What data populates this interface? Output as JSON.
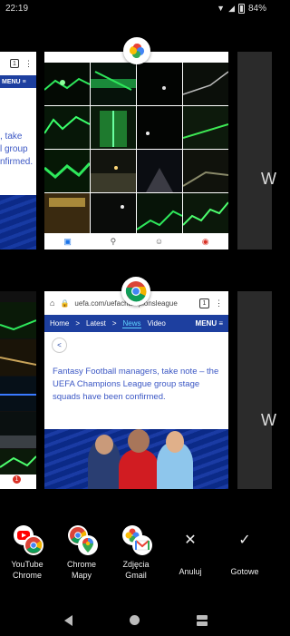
{
  "status_bar": {
    "time": "22:19",
    "battery": "84%"
  },
  "left_top_card": {
    "tab_count": "1",
    "nav_menu": "MENU",
    "snippet": ", take\nl group\nnfirmed."
  },
  "right_cards": {
    "top_letter": "W",
    "bottom_letter": "W"
  },
  "chrome_card": {
    "url": "uefa.com/uefachampionsleague",
    "tab_count": "1",
    "nav_items": [
      "Home",
      ">",
      "Latest",
      ">",
      "News",
      "Video"
    ],
    "nav_menu": "MENU ≡",
    "article_text": "Fantasy Football managers, take note – the UEFA Champions League group stage squads have been confirmed."
  },
  "left_bottom_card": {
    "badge": "1"
  },
  "app_pairs": [
    {
      "label_line1": "YouTube",
      "label_line2": "Chrome",
      "icons": [
        "youtube-icon",
        "chrome-icon"
      ]
    },
    {
      "label_line1": "Chrome",
      "label_line2": "Mapy",
      "icons": [
        "chrome-icon",
        "maps-icon"
      ]
    },
    {
      "label_line1": "Zdjęcia",
      "label_line2": "Gmail",
      "icons": [
        "photos-icon",
        "gmail-icon"
      ]
    }
  ],
  "actions": {
    "cancel_label": "Anuluj",
    "done_label": "Gotowe"
  },
  "colors": {
    "uefa_blue": "#1d3f9f",
    "link_blue": "#3b57c4",
    "photo_green": "#2ee85b"
  }
}
